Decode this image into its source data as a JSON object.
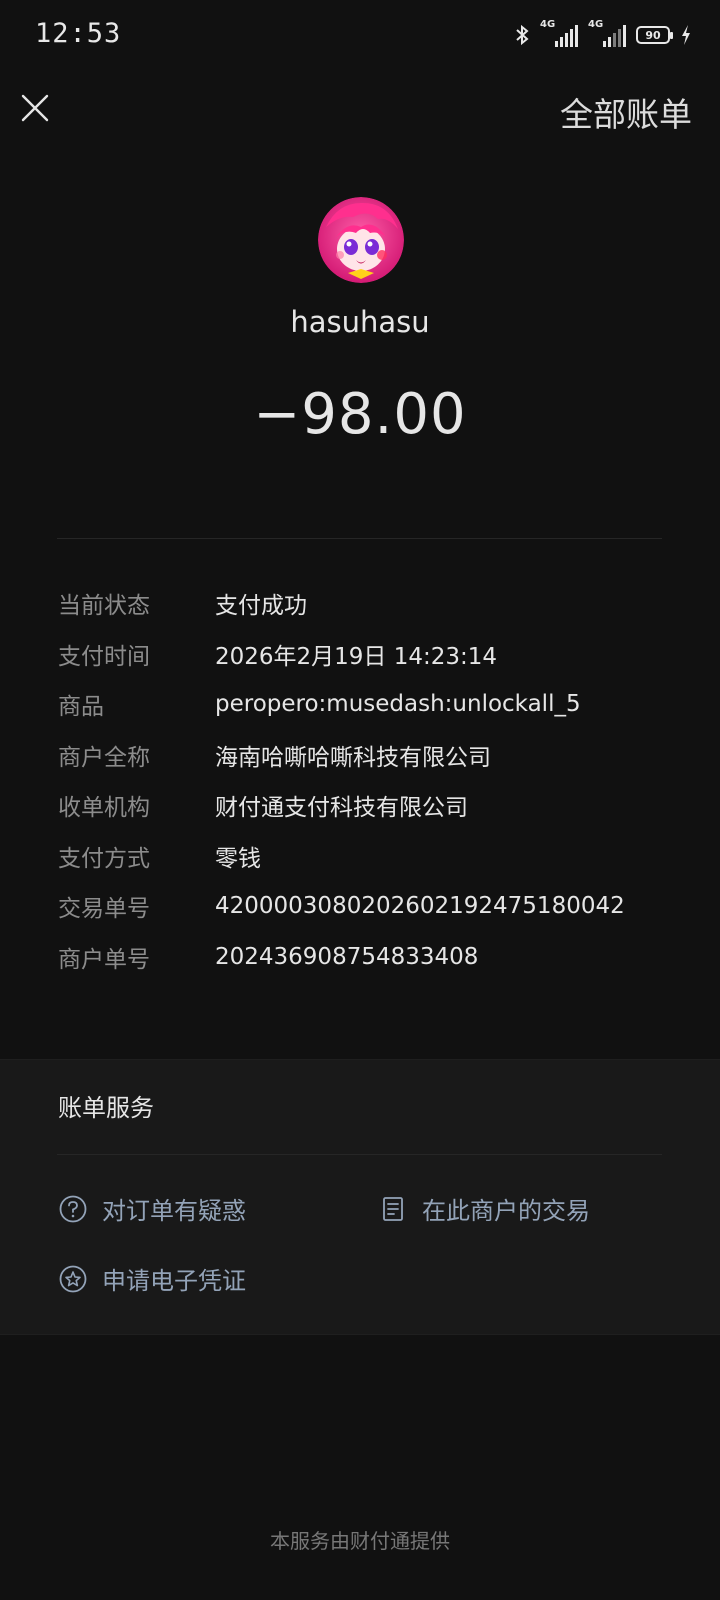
{
  "status_bar": {
    "time": "12:53",
    "network1": "4G",
    "network2": "4G",
    "battery": "90",
    "icons": [
      "bluetooth-icon",
      "signal-icon",
      "signal-icon",
      "battery-icon",
      "charging-icon"
    ]
  },
  "header": {
    "close_icon": "close-icon",
    "all_bills_label": "全部账单"
  },
  "merchant": {
    "name": "hasuhasu",
    "amount": "−98.00"
  },
  "details": [
    {
      "key": "当前状态",
      "value": "支付成功"
    },
    {
      "key": "支付时间",
      "value": "2026年2月19日 14:23:14"
    },
    {
      "key": "商品",
      "value": "peropero:musedash:unlockall_5"
    },
    {
      "key": "商户全称",
      "value": "海南哈嘶哈嘶科技有限公司"
    },
    {
      "key": "收单机构",
      "value": "财付通支付科技有限公司"
    },
    {
      "key": "支付方式",
      "value": "零钱"
    },
    {
      "key": "交易单号",
      "value": "4200003080202602192475180042"
    },
    {
      "key": "商户单号",
      "value": "202436908754833408"
    }
  ],
  "services": {
    "title": "账单服务",
    "items": [
      {
        "label": "对订单有疑惑",
        "icon": "question-icon"
      },
      {
        "label": "在此商户的交易",
        "icon": "document-icon"
      },
      {
        "label": "申请电子凭证",
        "icon": "star-badge-icon"
      }
    ]
  },
  "footer": "本服务由财付通提供",
  "colors": {
    "background": "#111111",
    "section": "#191919",
    "text": "#e6e6e6",
    "muted": "#8c8c8c",
    "link": "#93a3b8"
  }
}
